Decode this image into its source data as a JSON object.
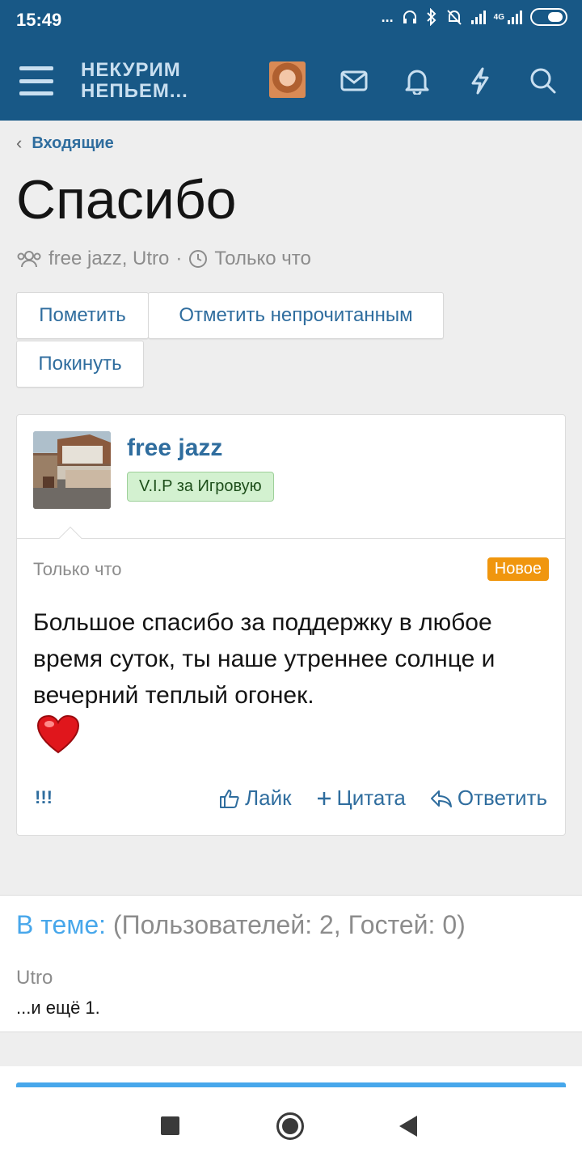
{
  "status": {
    "time": "15:49",
    "dots": "...",
    "network": "4G"
  },
  "header": {
    "logo_line1": "НЕКУРИМ",
    "logo_line2": "НЕПЬЕМ...",
    "icons": [
      "menu-icon",
      "avatar",
      "mail-icon",
      "bell-icon",
      "lightning-icon",
      "search-icon"
    ]
  },
  "breadcrumb": {
    "label": "Входящие"
  },
  "page": {
    "title": "Спасибо",
    "participants": "free jazz, Utro",
    "separator": "·",
    "time": "Только что"
  },
  "buttons": {
    "mark": "Пометить",
    "mark_unread": "Отметить непрочитанным",
    "leave": "Покинуть"
  },
  "message": {
    "author": "free jazz",
    "badge": "V.I.P за Игровую",
    "time": "Только что",
    "new_label": "Новое",
    "body": "Большое спасибо за поддержку в любое время суток, ты наше утреннее солнце и вечерний теплый огонек.",
    "reactions": "!!!",
    "like": "Лайк",
    "quote": "Цитата",
    "reply": "Ответить"
  },
  "online": {
    "label": "В теме:",
    "counts": "(Пользователей: 2, Гостей: 0)",
    "user": "Utro",
    "more": "...и ещё 1."
  },
  "colors": {
    "header_bg": "#185886",
    "link": "#2f6d9e",
    "accent": "#47a7eb",
    "new_badge": "#f0960e",
    "vip_badge": "#d3f1d0"
  }
}
